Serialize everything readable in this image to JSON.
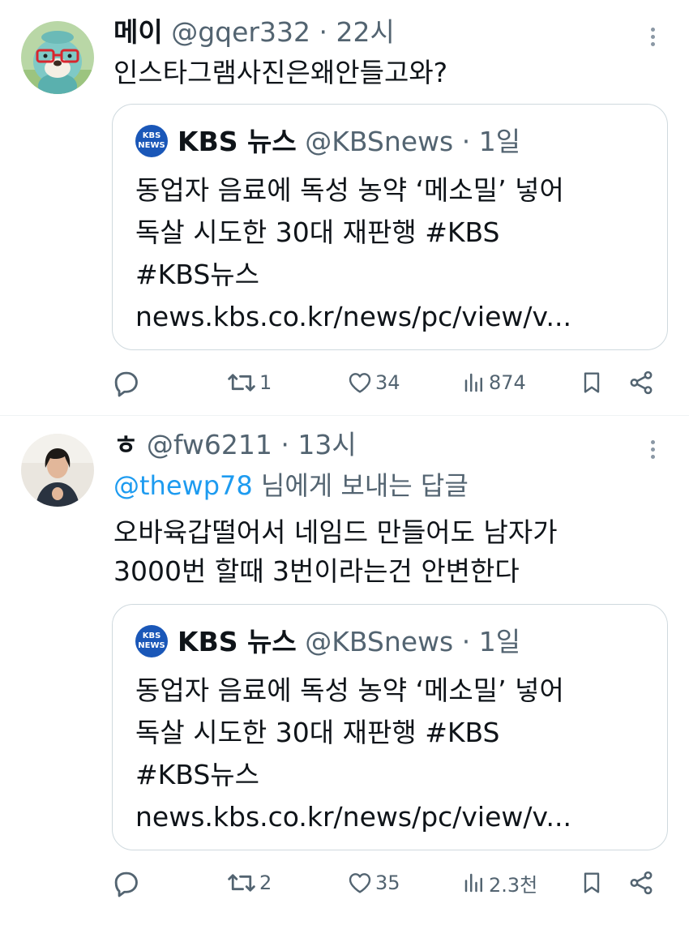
{
  "tweets": [
    {
      "name": "메이",
      "handle": "@gqer332",
      "time": "22시",
      "separator": "·",
      "reply_to": null,
      "text": "인스타그램사진은왜안들고와?",
      "quote": {
        "logo": "KBS NEWS",
        "name": "KBS 뉴스",
        "handle": "@KBSnews",
        "time": "1일",
        "separator": "·",
        "line1": "동업자 음료에 독성 농약 ‘메소밀’ 넣어",
        "line2": "독살 시도한 30대 재판행 #KBS",
        "line3": "#KBS뉴스",
        "line4": "news.kbs.co.kr/news/pc/view/v..."
      },
      "stats": {
        "replies": "",
        "retweets": "1",
        "likes": "34",
        "views": "874"
      }
    },
    {
      "name": "ㅎ",
      "handle": "@fw6211",
      "time": "13시",
      "separator": "·",
      "reply_mention": "@thewp78",
      "reply_suffix": "님에게 보내는 답글",
      "text_line1": "오바육갑떨어서 네임드 만들어도 남자가",
      "text_line2": "3000번 할때 3번이라는건 안변한다",
      "quote": {
        "logo": "KBS NEWS",
        "name": "KBS 뉴스",
        "handle": "@KBSnews",
        "time": "1일",
        "separator": "·",
        "line1": "동업자 음료에 독성 농약 ‘메소밀’ 넣어",
        "line2": "독살 시도한 30대 재판행 #KBS",
        "line3": "#KBS뉴스",
        "line4": "news.kbs.co.kr/news/pc/view/v..."
      },
      "stats": {
        "replies": "",
        "retweets": "2",
        "likes": "35",
        "views": "2.3천"
      }
    }
  ],
  "colors": {
    "text": "#0f1419",
    "secondary": "#536471",
    "link": "#1d9bf0",
    "border": "#cfd9de",
    "kbs": "#1a57b8"
  },
  "icons": [
    "reply-icon",
    "retweet-icon",
    "like-icon",
    "views-icon",
    "bookmark-icon",
    "share-icon",
    "more-icon"
  ]
}
